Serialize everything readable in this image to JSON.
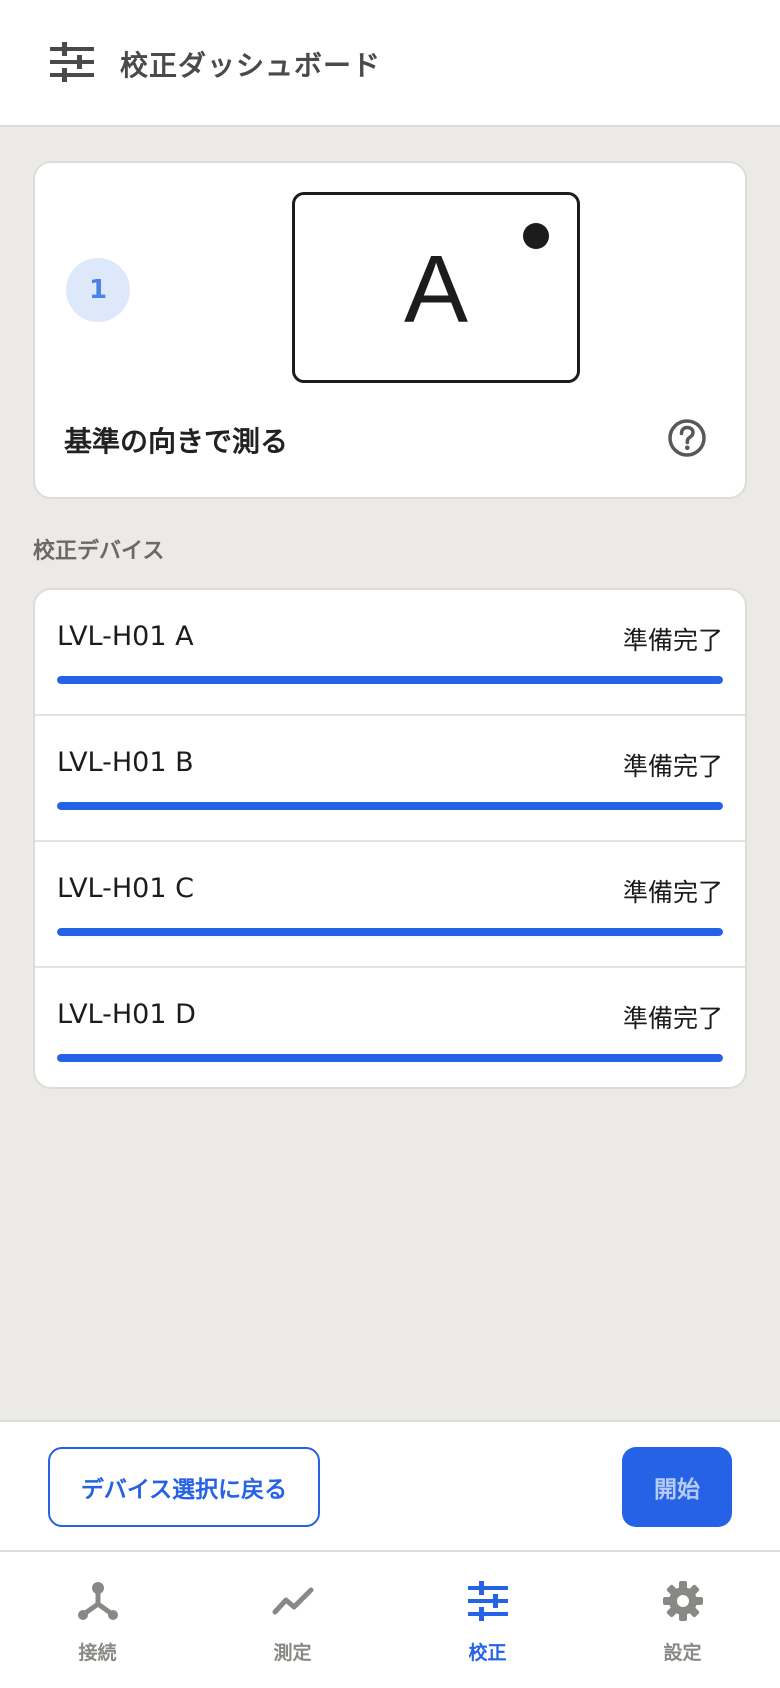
{
  "header": {
    "title": "校正ダッシュボード",
    "icon": "sliders-icon"
  },
  "orientation_card": {
    "step_number": "1",
    "device_letter": "A",
    "instruction": "基準の向きで測る",
    "help_icon": "help-circle-icon"
  },
  "devices": {
    "section_title": "校正デバイス",
    "items": [
      {
        "name": "LVL-H01 A",
        "status": "準備完了",
        "progress": 1.0
      },
      {
        "name": "LVL-H01 B",
        "status": "準備完了",
        "progress": 1.0
      },
      {
        "name": "LVL-H01 C",
        "status": "準備完了",
        "progress": 1.0
      },
      {
        "name": "LVL-H01 D",
        "status": "準備完了",
        "progress": 1.0
      }
    ]
  },
  "footer": {
    "back_label": "デバイス選択に戻る",
    "start_label": "開始"
  },
  "tabs": [
    {
      "label": "接続",
      "icon": "connection-icon",
      "active": false
    },
    {
      "label": "測定",
      "icon": "trend-chart-icon",
      "active": false
    },
    {
      "label": "校正",
      "icon": "sliders-icon",
      "active": true
    },
    {
      "label": "設定",
      "icon": "gear-icon",
      "active": false
    }
  ],
  "colors": {
    "accent": "#2662e6",
    "background": "#ebeae7",
    "inactive_tab": "#8a8885"
  }
}
